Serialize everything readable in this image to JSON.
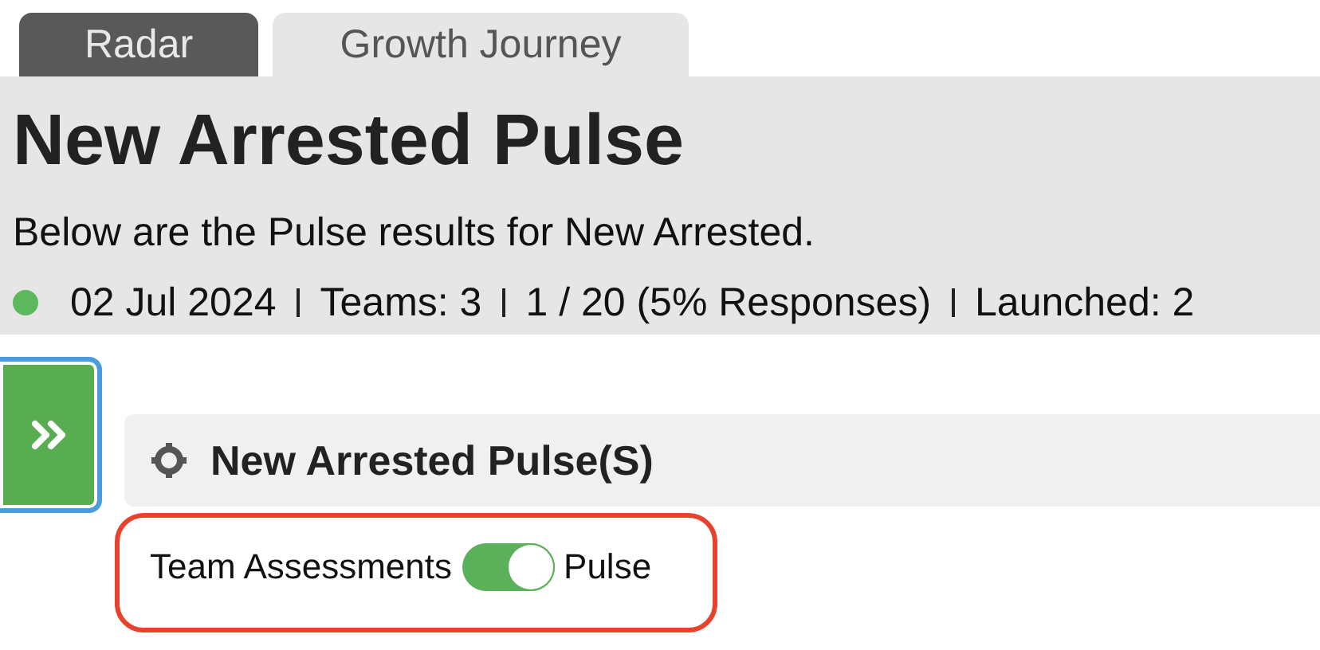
{
  "tabs": [
    {
      "label": "Radar",
      "selected": false
    },
    {
      "label": "Growth Journey",
      "selected": true
    }
  ],
  "header": {
    "title": "New Arrested Pulse",
    "description": "Below are the Pulse results for New Arrested.",
    "active": true,
    "meta": [
      "02 Jul 2024",
      "Teams: 3",
      "1 / 20 (5% Responses)",
      "Launched: 2"
    ]
  },
  "section": {
    "title": "New Arrested Pulse(S)"
  },
  "toggle": {
    "left_label": "Team Assessments",
    "right_label": "Pulse",
    "on": true
  }
}
